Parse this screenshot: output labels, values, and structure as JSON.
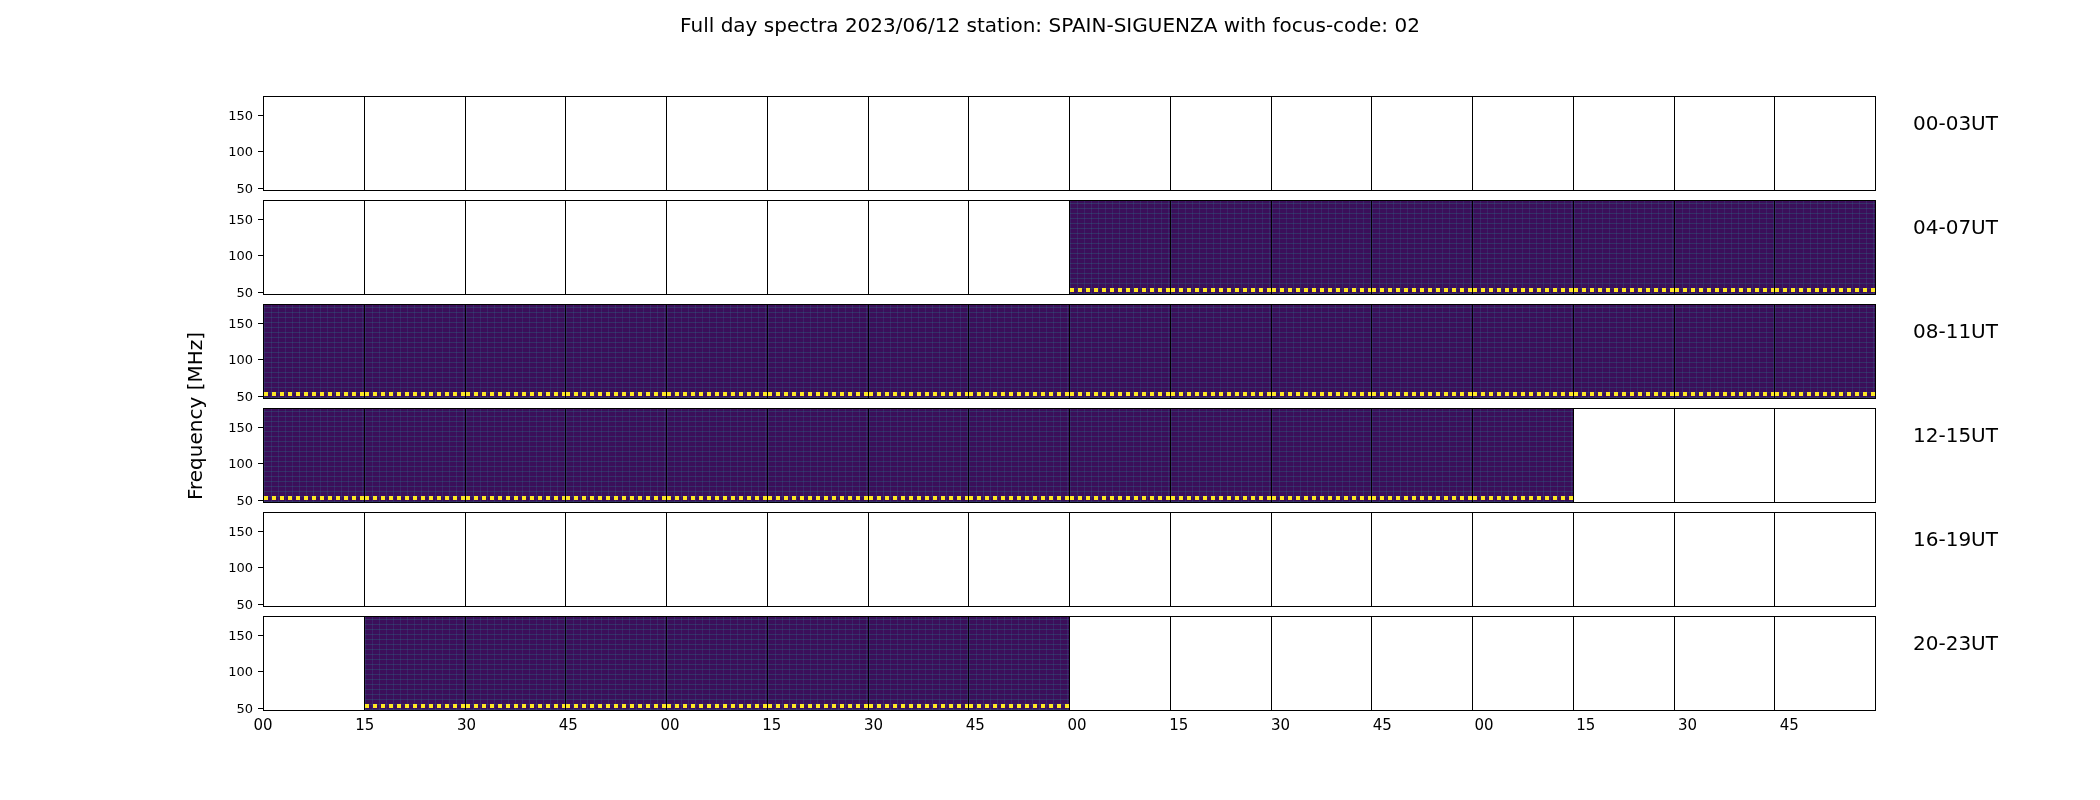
{
  "title": "Full day spectra 2023/06/12 station: SPAIN-SIGUENZA with focus-code: 02",
  "ylabel": "Frequency [MHz]",
  "rows": [
    {
      "label": "00-03UT",
      "yticks": [
        "150",
        "100",
        "50"
      ],
      "panels": [
        false,
        false,
        false,
        false,
        false,
        false,
        false,
        false,
        false,
        false,
        false,
        false,
        false,
        false,
        false,
        false
      ]
    },
    {
      "label": "04-07UT",
      "yticks": [
        "150",
        "100",
        "50"
      ],
      "panels": [
        false,
        false,
        false,
        false,
        false,
        false,
        false,
        false,
        true,
        true,
        true,
        true,
        true,
        true,
        true,
        true
      ]
    },
    {
      "label": "08-11UT",
      "yticks": [
        "150",
        "100",
        "50"
      ],
      "panels": [
        true,
        true,
        true,
        true,
        true,
        true,
        true,
        true,
        true,
        true,
        true,
        true,
        true,
        true,
        true,
        true
      ]
    },
    {
      "label": "12-15UT",
      "yticks": [
        "150",
        "100",
        "50"
      ],
      "panels": [
        true,
        true,
        true,
        true,
        true,
        true,
        true,
        true,
        true,
        true,
        true,
        true,
        true,
        false,
        false,
        false
      ]
    },
    {
      "label": "16-19UT",
      "yticks": [
        "150",
        "100",
        "50"
      ],
      "panels": [
        false,
        false,
        false,
        false,
        false,
        false,
        false,
        false,
        false,
        false,
        false,
        false,
        false,
        false,
        false,
        false
      ]
    },
    {
      "label": "20-23UT",
      "yticks": [
        "150",
        "100",
        "50"
      ],
      "panels": [
        false,
        true,
        true,
        true,
        true,
        true,
        true,
        true,
        false,
        false,
        false,
        false,
        false,
        false,
        false,
        false
      ]
    }
  ],
  "xticks": [
    "00",
    "15",
    "30",
    "45",
    "00",
    "15",
    "30",
    "45",
    "00",
    "15",
    "30",
    "45",
    "00",
    "15",
    "30",
    "45"
  ]
}
